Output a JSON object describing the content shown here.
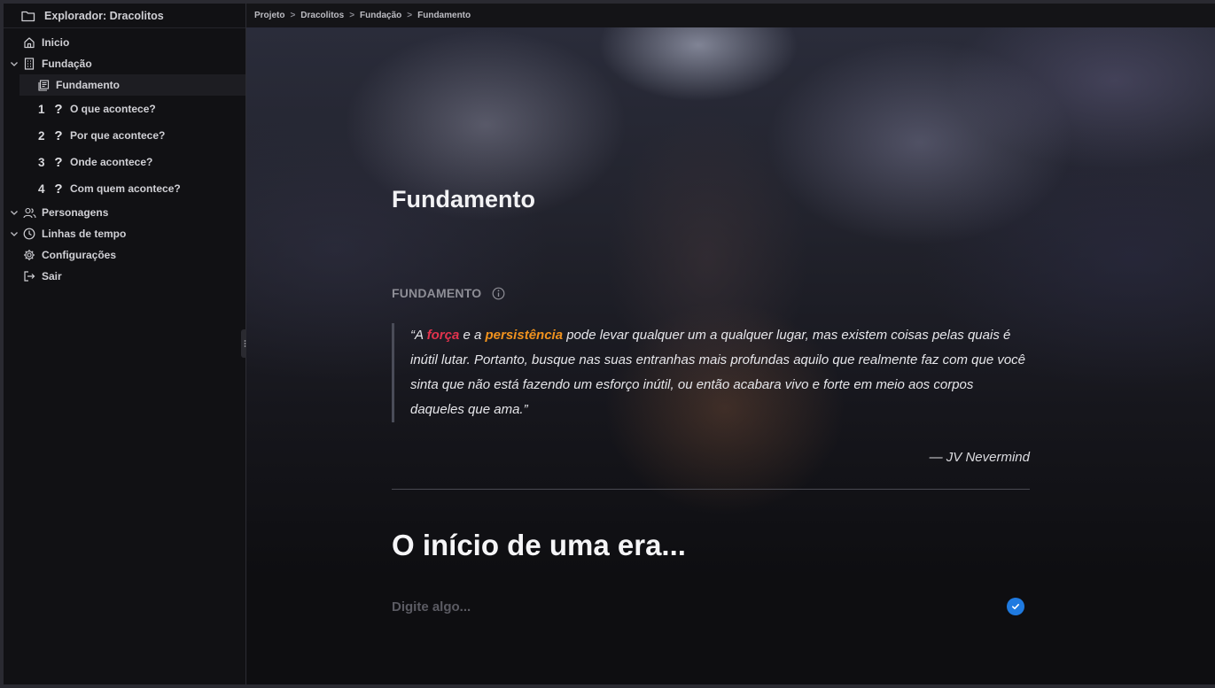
{
  "sidebar": {
    "explorer_title": "Explorador: Dracolitos",
    "items": {
      "inicio": "Inicio",
      "fundacao": "Fundação",
      "fundamento": "Fundamento",
      "personagens": "Personagens",
      "linhas": "Linhas de tempo",
      "config": "Configurações",
      "sair": "Sair"
    },
    "questions": [
      {
        "num": "1",
        "label": "O que acontece?"
      },
      {
        "num": "2",
        "label": "Por que acontece?"
      },
      {
        "num": "3",
        "label": "Onde acontece?"
      },
      {
        "num": "4",
        "label": "Com quem acontece?"
      }
    ]
  },
  "breadcrumb": [
    "Projeto",
    "Dracolitos",
    "Fundação",
    "Fundamento"
  ],
  "breadcrumb_sep": ">",
  "main": {
    "title": "Fundamento",
    "section_label": "FUNDAMENTO",
    "quote": {
      "open": "“A ",
      "word1": "força",
      "mid": " e a ",
      "word2": "persistência",
      "rest": " pode levar qualquer um a qualquer lugar, mas existem coisas pelas quais é inútil lutar. Portanto, busque nas suas entranhas mais profundas aquilo que realmente faz com que você sinta que não está fazendo um esforço inútil, ou então acabara vivo e forte em meio aos corpos daqueles que ama.”",
      "author": "— JV Nevermind"
    },
    "heading2": "O início de uma era...",
    "input_placeholder": "Digite algo..."
  },
  "colors": {
    "accent_red": "#e2334d",
    "accent_orange": "#f0921e",
    "check_blue": "#1f7ae0"
  }
}
